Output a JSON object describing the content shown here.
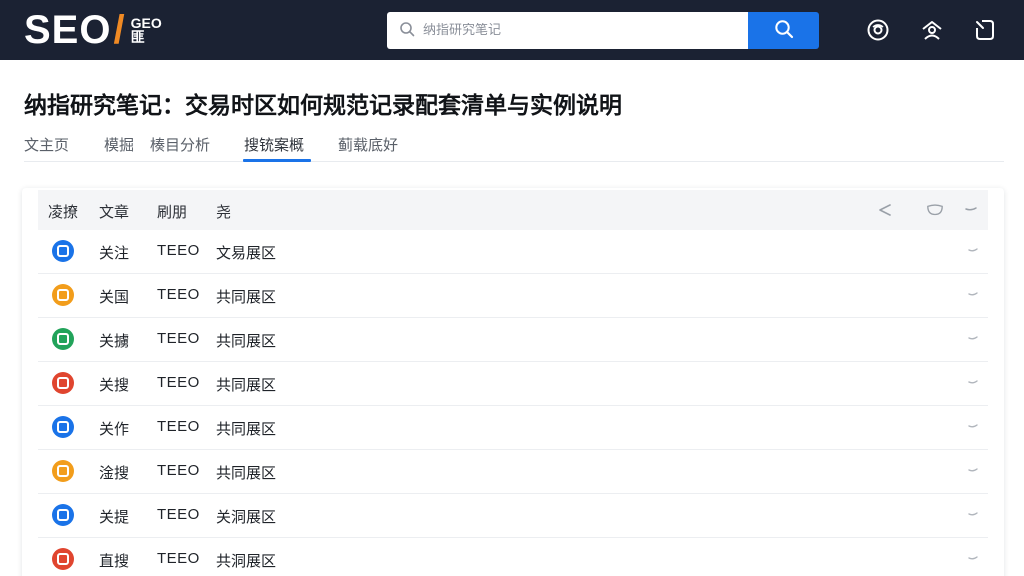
{
  "header": {
    "logo": {
      "main": "SEO",
      "slash": "/",
      "sub_top": "GEO",
      "sub_bottom": "匪"
    },
    "search": {
      "placeholder": "纳指研究笔记"
    },
    "icons": [
      "eye-icon",
      "user-icon",
      "exit-icon"
    ]
  },
  "page": {
    "title": "纳指研究笔记：交易时区如何规范记录配套清单与实例说明"
  },
  "tabs": [
    {
      "label": "文主页",
      "active": false
    },
    {
      "label": "模掘",
      "active": false
    },
    {
      "label": "楱目分析",
      "active": false
    },
    {
      "label": "搜铳案概",
      "active": true
    },
    {
      "label": "蓟载底好",
      "active": false
    }
  ],
  "table": {
    "headers": [
      "凌撩",
      "文章",
      "刷朋",
      "尧"
    ],
    "header_icons": [
      "share-icon",
      "comment-icon",
      "chevron-down-icon"
    ],
    "rows": [
      {
        "icon_color": "#1a73e8",
        "col1": "关注",
        "col2": "TEEO",
        "col3": "文易展区"
      },
      {
        "icon_color": "#f29d1b",
        "col1": "关国",
        "col2": "TEEO",
        "col3": "共同展区"
      },
      {
        "icon_color": "#22a35a",
        "col1": "关擄",
        "col2": "TEEO",
        "col3": "共同展区"
      },
      {
        "icon_color": "#e0452f",
        "col1": "关搜",
        "col2": "TEEO",
        "col3": "共同展区"
      },
      {
        "icon_color": "#1a73e8",
        "col1": "关作",
        "col2": "TEEO",
        "col3": "共同展区"
      },
      {
        "icon_color": "#f29d1b",
        "col1": "淦搜",
        "col2": "TEEO",
        "col3": "共同展区"
      },
      {
        "icon_color": "#1a73e8",
        "col1": "关提",
        "col2": "TEEO",
        "col3": "关洞展区"
      },
      {
        "icon_color": "#e0452f",
        "col1": "直搜",
        "col2": "TEEO",
        "col3": "共洞展区"
      }
    ]
  },
  "colors": {
    "header_bg": "#1b2233",
    "accent": "#1a73e8",
    "logo_slash": "#f08a24"
  }
}
